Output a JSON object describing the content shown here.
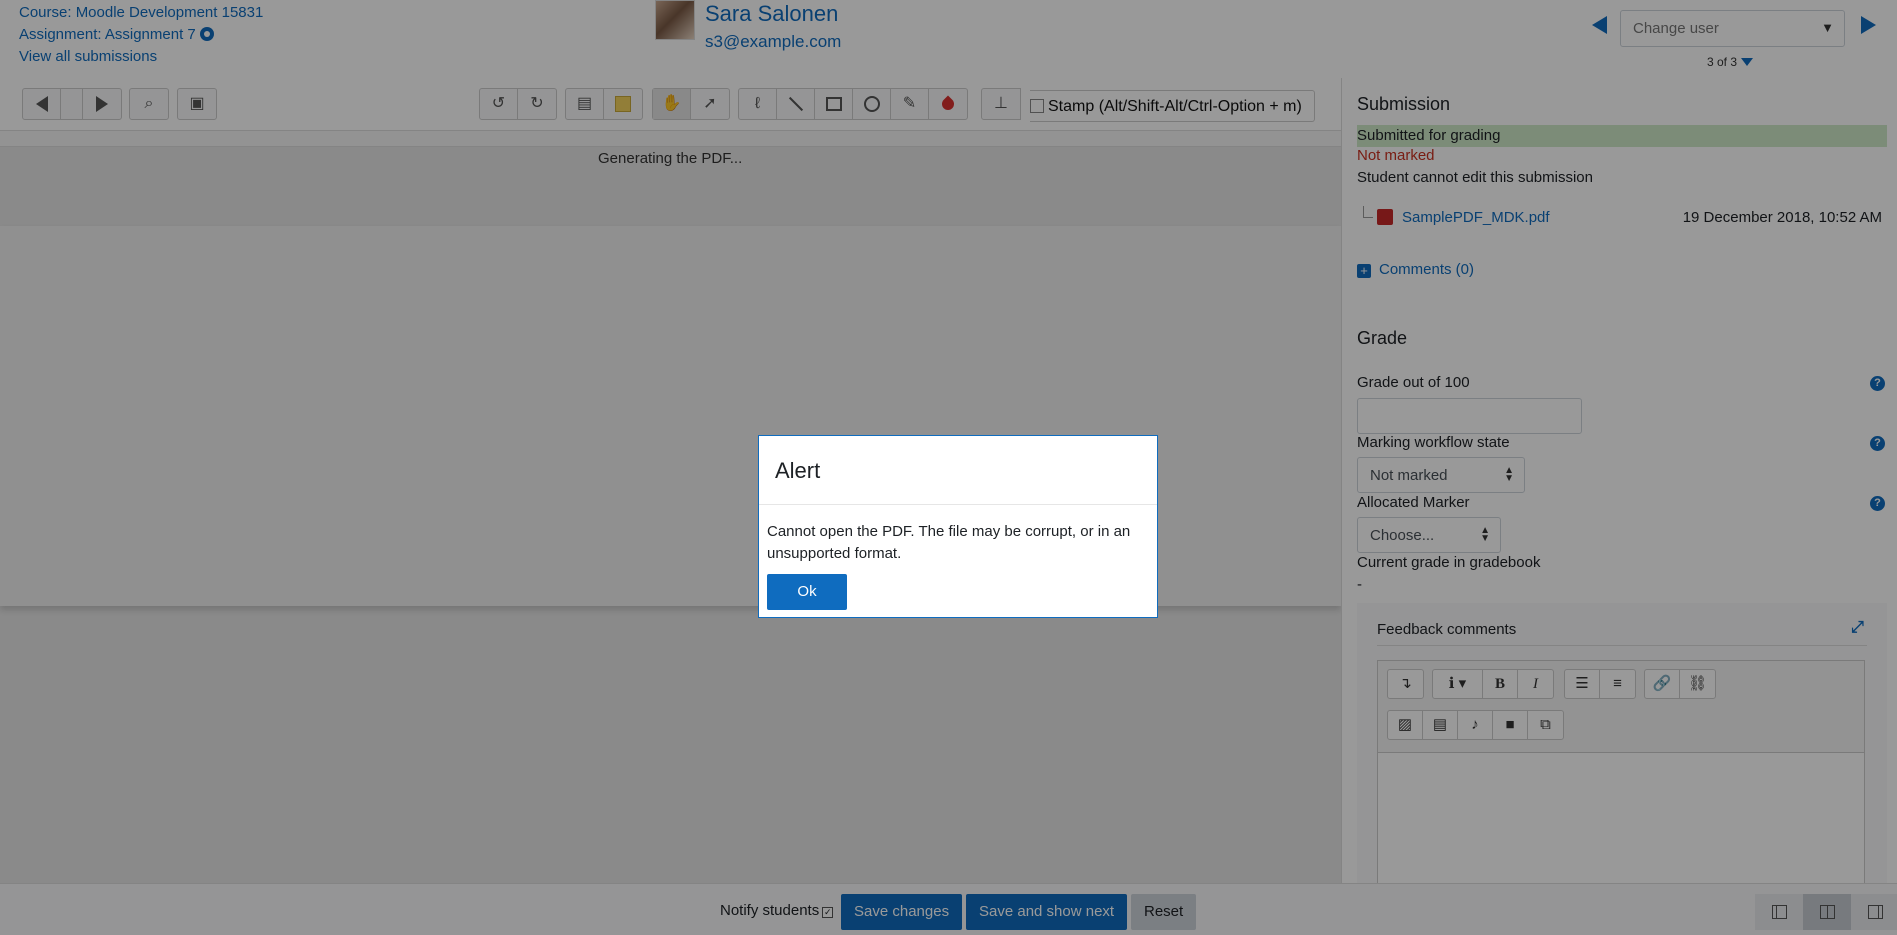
{
  "header": {
    "course_link": "Course: Moodle Development 15831",
    "assignment_link": "Assignment: Assignment 7",
    "view_all": "View all submissions",
    "user_name": "Sara Salonen",
    "user_email": "s3@example.com",
    "change_user_placeholder": "Change user",
    "counter": "3 of 3"
  },
  "pdf": {
    "stamp_label": "Stamp (Alt/Shift-Alt/Ctrl-Option + m)",
    "status_text": "Generating the PDF..."
  },
  "submission": {
    "title": "Submission",
    "status_submitted": "Submitted for grading",
    "status_marking": "Not marked",
    "edit_status": "Student cannot edit this submission",
    "file_name": "SamplePDF_MDK.pdf",
    "file_date": "19 December 2018, 10:52 AM",
    "comments": "Comments (0)"
  },
  "grade": {
    "title": "Grade",
    "grade_label": "Grade out of 100",
    "grade_value": "",
    "workflow_label": "Marking workflow state",
    "workflow_value": "Not marked",
    "marker_label": "Allocated Marker",
    "marker_value": "Choose...",
    "gradebook_label": "Current grade in gradebook",
    "gradebook_value": "-",
    "feedback_label": "Feedback comments"
  },
  "footer": {
    "notify_label": "Notify students",
    "notify_checked": true,
    "save_changes": "Save changes",
    "save_next": "Save and show next",
    "reset": "Reset"
  },
  "modal": {
    "title": "Alert",
    "message": "Cannot open the PDF. The file may be corrupt, or in an unsupported format.",
    "ok": "Ok"
  },
  "colors": {
    "accent": "#0f6cbf",
    "success_bg": "#cfeac8",
    "danger": "#ca3120"
  },
  "icons": [
    "settings-gear-icon",
    "prev-user-icon",
    "next-user-icon",
    "filter-icon",
    "pdf-file-icon",
    "help-icon",
    "expand-icon"
  ]
}
